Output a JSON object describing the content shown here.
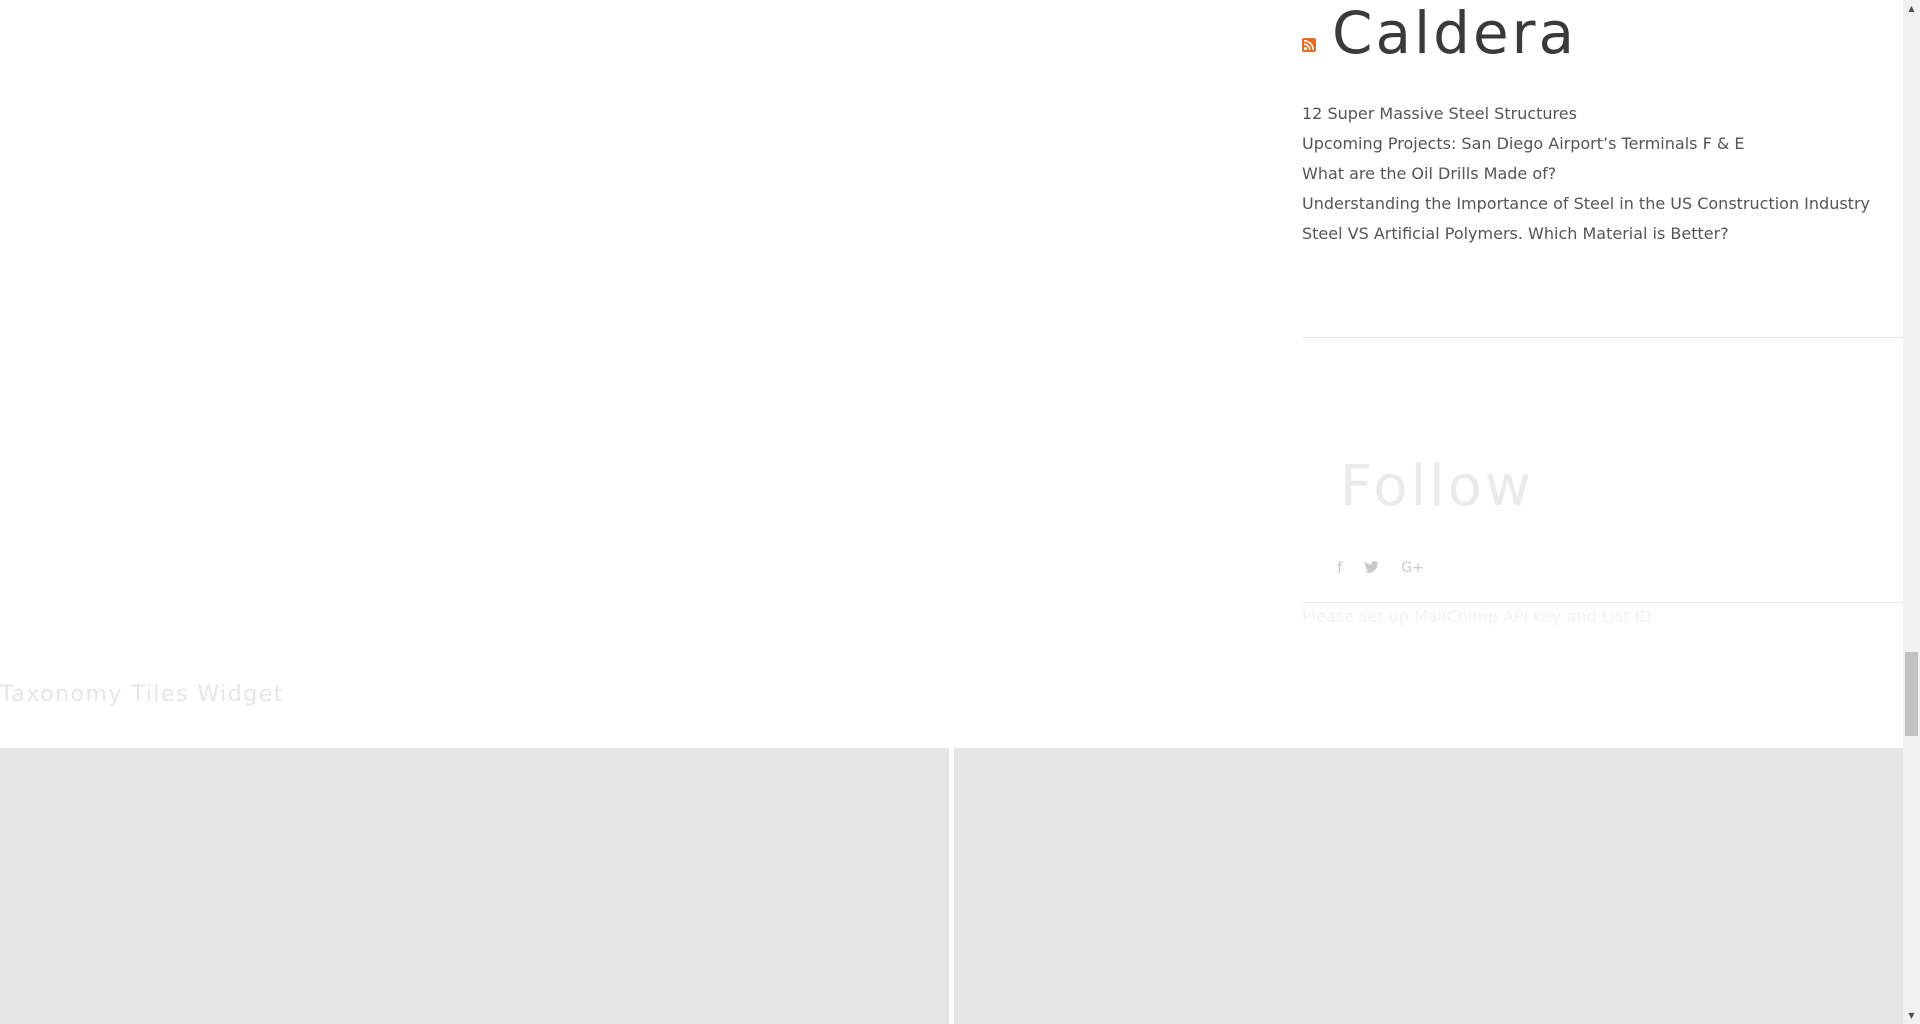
{
  "rss_widget": {
    "icon": "rss-feed-icon",
    "title": "Caldera",
    "items": [
      "12 Super Massive Steel Structures",
      "Upcoming Projects: San Diego Airport’s Terminals F & E",
      "What are the Oil Drills Made of?",
      "Understanding the Importance of Steel in the US Construction Industry",
      "Steel VS Artificial Polymers. Which Material is Better?"
    ]
  },
  "follow_widget": {
    "title": "Follow",
    "social_icons": [
      {
        "name": "facebook-icon",
        "glyph": "f"
      },
      {
        "name": "twitter-icon",
        "glyph": "🐦"
      },
      {
        "name": "google-plus-icon",
        "glyph": "G+"
      }
    ]
  },
  "mailchimp": {
    "message": "Please set up MailChimp API key and List ID"
  },
  "taxonomy_tiles": {
    "title": "Taxonomy Tiles Widget",
    "tile_color": "#e5e5e5"
  },
  "colors": {
    "rss_orange": "#e66b1e",
    "heading_dark": "#3a3a3a",
    "link_gray": "#555555"
  }
}
